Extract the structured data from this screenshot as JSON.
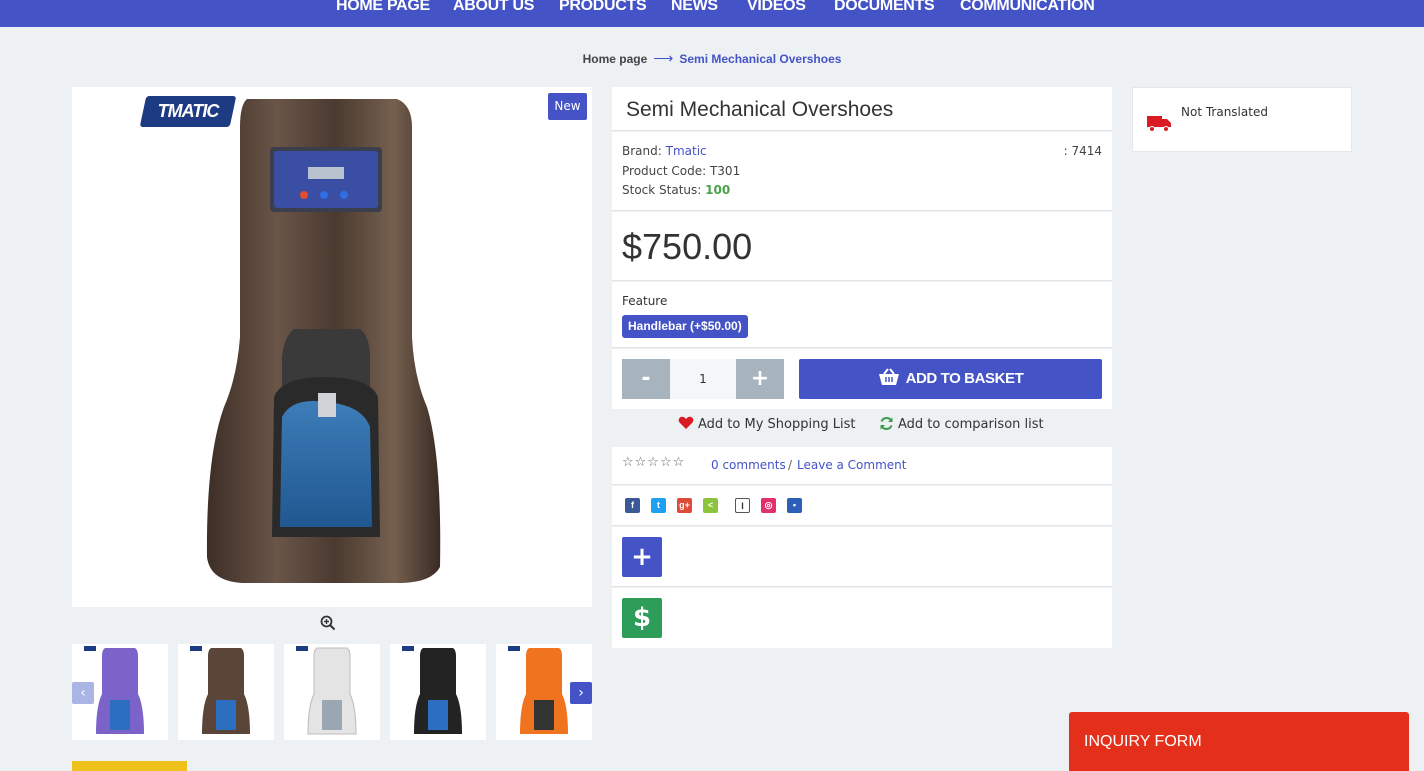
{
  "nav": {
    "items": [
      "HOME PAGE",
      "ABOUT US",
      "PRODUCTS",
      "NEWS",
      "VIDEOS",
      "DOCUMENTS",
      "COMMUNICATION"
    ]
  },
  "breadcrumb": {
    "home": "Home page",
    "current": "Semi Mechanical Overshoes"
  },
  "gallery": {
    "badge": "New",
    "logo_text": "TMATIC",
    "thumbnail_colors": [
      "#7b63c9",
      "#5a4538",
      "#e4e4e4",
      "#232323",
      "#f0731f"
    ]
  },
  "product": {
    "title": "Semi Mechanical Overshoes",
    "brand_label": "Brand:",
    "brand": "Tmatic",
    "code_label": "Product Code:",
    "code": "T301",
    "stock_label": "Stock Status:",
    "stock": "100",
    "right_code": ": 7414",
    "price": "$750.00",
    "feature_label": "Feature",
    "feature_option": "Handlebar (+$50.00)",
    "quantity": "1",
    "minus": "-",
    "plus": "+",
    "add_to_basket": "ADD TO BASKET",
    "shopping_list": "Add to My Shopping List",
    "comparison_list": "Add to comparison list",
    "comments": "0 comments",
    "comment_sep": "/",
    "leave_comment": "Leave a Comment",
    "stars": "☆☆☆☆☆",
    "plus_btn": "+",
    "dollar_btn": "$"
  },
  "shipping": {
    "text": "Not Translated"
  },
  "inquiry": {
    "label": "INQUIRY FORM"
  },
  "colors": {
    "accent": "#4453c6",
    "inquiry": "#e4301a",
    "stock_green": "#4aa24a",
    "dollar_green": "#2e9d5a"
  }
}
